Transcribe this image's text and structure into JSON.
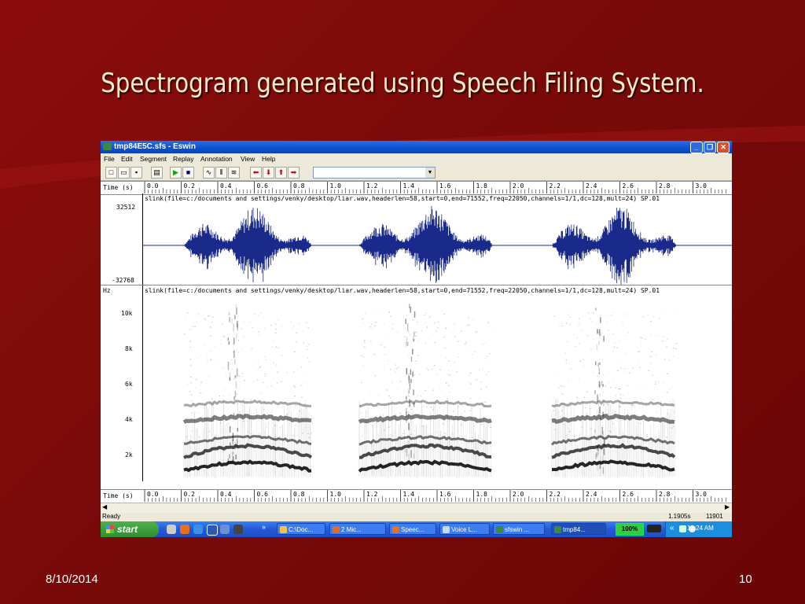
{
  "slide": {
    "title": "Spectrogram generated using Speech Filing System.",
    "date": "8/10/2014",
    "page_number": "10"
  },
  "window": {
    "title": "tmp84E5C.sfs - Eswin",
    "menu": [
      "File",
      "Edit",
      "Segment",
      "Replay",
      "Annotation",
      "View",
      "Help"
    ],
    "controls": [
      "_",
      "❐",
      "✕"
    ]
  },
  "toolbar": {
    "buttons": [
      "new-icon",
      "open-icon",
      "save-icon",
      "print-icon",
      "play-icon",
      "stop-icon",
      "waveform-icon",
      "spectrogram-icon",
      "lines-icon",
      "arrow-left-icon",
      "arrow-down-icon",
      "arrow-up-icon",
      "arrow-right-icon"
    ],
    "dropdown_value": ""
  },
  "axis": {
    "label": "Time (s)",
    "ticks": [
      "0.0",
      "0.2",
      "0.4",
      "0.6",
      "0.8",
      "1.0",
      "1.2",
      "1.4",
      "1.6",
      "1.8",
      "2.0",
      "2.2",
      "2.4",
      "2.6",
      "2.8",
      "3.0"
    ]
  },
  "waveform": {
    "header": "slink(file=c:/documents and settings/venky/desktop/liar.wav,headerlen=58,start=0,end=71552,freq=22050,channels=1/1,dc=128,mult=24) SP.01",
    "ymax": "32512",
    "ymin": "-32768",
    "color": "#1a2a8a"
  },
  "spectrogram": {
    "header": "slink(file=c:/documents and settings/venky/desktop/liar.wav,headerlen=58,start=0,end=71552,freq=22050,channels=1/1,dc=128,mult=24) SP.01",
    "unit": "Hz",
    "yticks": [
      "10k",
      "8k",
      "6k",
      "4k",
      "2k"
    ]
  },
  "status": {
    "left": "Ready",
    "time": "1.1905s",
    "sample": "11901"
  },
  "taskbar": {
    "start": "start",
    "tasks": [
      "C:\\Doc...",
      "2 Mic...",
      "Speec...",
      "Voice L...",
      "sfswin ...",
      "tmp84..."
    ],
    "battery": "100%",
    "clock": "12:24 AM",
    "chevron": "»"
  }
}
